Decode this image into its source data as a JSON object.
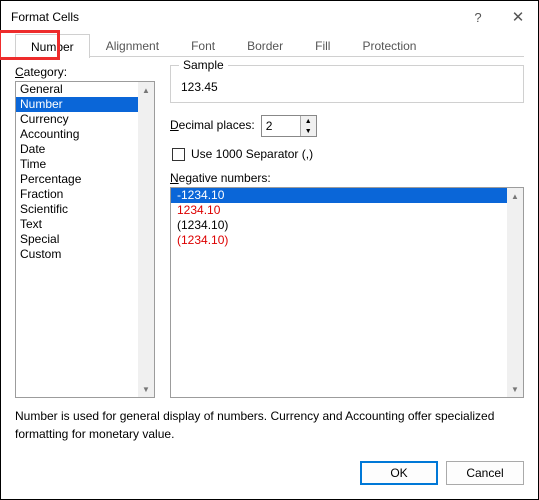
{
  "window": {
    "title": "Format Cells",
    "help": "?",
    "close": "✕"
  },
  "tabs": {
    "items": [
      "Number",
      "Alignment",
      "Font",
      "Border",
      "Fill",
      "Protection"
    ],
    "active": 0
  },
  "category": {
    "label_prefix": "C",
    "label_rest": "ategory:",
    "items": [
      "General",
      "Number",
      "Currency",
      "Accounting",
      "Date",
      "Time",
      "Percentage",
      "Fraction",
      "Scientific",
      "Text",
      "Special",
      "Custom"
    ],
    "selected": 1
  },
  "sample": {
    "group_label": "Sample",
    "value": "123.45"
  },
  "decimal": {
    "label_prefix": "D",
    "label_rest": "ecimal places:",
    "value": "2"
  },
  "separator": {
    "label_before": "U",
    "label_after": "se 1000 Separator (,)",
    "checked": false
  },
  "negative": {
    "label_prefix": "N",
    "label_rest": "egative numbers:",
    "items": [
      {
        "text": "-1234.10",
        "red": false
      },
      {
        "text": "1234.10",
        "red": true
      },
      {
        "text": "(1234.10)",
        "red": false
      },
      {
        "text": "(1234.10)",
        "red": true
      }
    ],
    "selected": 0
  },
  "description": "Number is used for general display of numbers.  Currency and Accounting offer specialized formatting for monetary value.",
  "buttons": {
    "ok": "OK",
    "cancel": "Cancel"
  }
}
